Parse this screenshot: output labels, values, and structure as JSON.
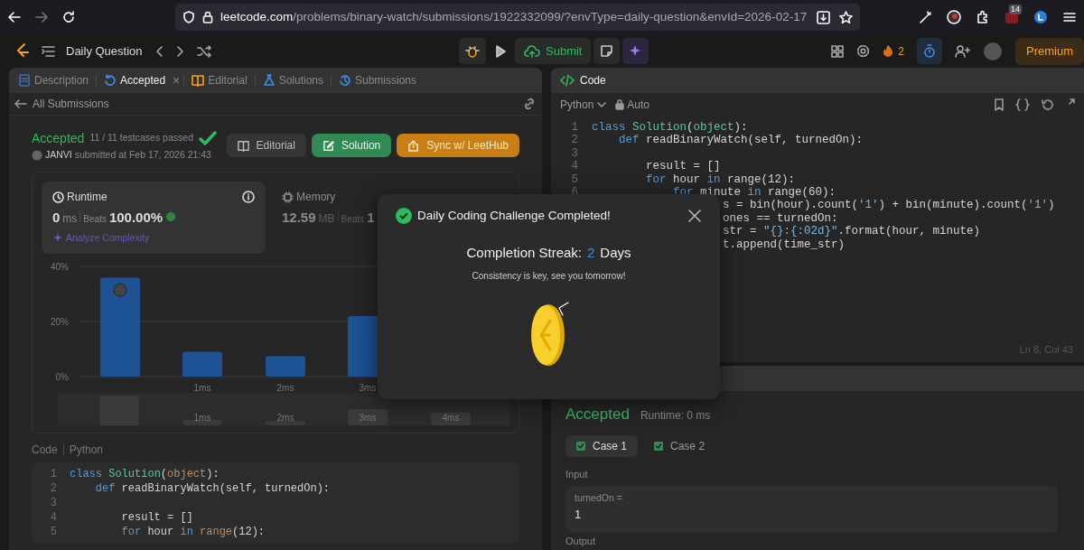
{
  "browser": {
    "url_host": "leetcode.com",
    "url_path": "/problems/binary-watch/submissions/1922332099/?envType=daily-question&envId=2026-02-17",
    "extension_badge": "14"
  },
  "top_nav": {
    "title": "Daily Question",
    "submit": "Submit",
    "streak_count": "2",
    "premium": "Premium"
  },
  "left_panel": {
    "tabs": [
      {
        "label": "Description",
        "selected": false
      },
      {
        "label": "Accepted",
        "selected": true,
        "close": "×"
      },
      {
        "label": "Editorial",
        "selected": false
      },
      {
        "label": "Solutions",
        "selected": false
      },
      {
        "label": "Submissions",
        "selected": false
      }
    ],
    "back_link": "All Submissions",
    "submission": {
      "status": "Accepted",
      "testcases": "11 / 11 testcases passed",
      "user": "JANVI",
      "submitted": "submitted at Feb 17, 2026 21:43"
    },
    "actions": [
      {
        "label": "Editorial",
        "kind": "plain"
      },
      {
        "label": "Solution",
        "kind": "green"
      },
      {
        "label": "Sync w/ LeetHub",
        "kind": "orange"
      }
    ],
    "stats": [
      {
        "title": "Runtime",
        "value": "0",
        "unit": "ms",
        "beats_label": "Beats",
        "beats": "100.00%",
        "link": "Analyze Complexity",
        "selected": true
      },
      {
        "title": "Memory",
        "value": "12.59",
        "unit": "MB",
        "beats_label": "Beats",
        "beats": "1",
        "selected": false
      }
    ],
    "chart_data": {
      "type": "bar",
      "categories": [
        null,
        "1ms",
        "2ms",
        "3ms"
      ],
      "values": [
        36,
        9,
        7.5,
        22
      ],
      "ylim": [
        0,
        40
      ],
      "yticks": [
        {
          "value": 0,
          "label": "0%"
        },
        {
          "value": 20,
          "label": "20%"
        },
        {
          "value": 40,
          "label": "40%"
        }
      ]
    },
    "navigator_labels": [
      "1ms",
      "2ms",
      "3ms",
      "4ms"
    ],
    "code_label": "Code",
    "code_language": "Python",
    "code": [
      {
        "number": "1",
        "segments": [
          {
            "text": "class",
            "kind": "keyword"
          },
          {
            "text": " Solution",
            "kind": "class"
          },
          {
            "text": "(",
            "kind": "plain"
          },
          {
            "text": "object",
            "kind": "builtin"
          },
          {
            "text": "):",
            "kind": "plain"
          }
        ]
      },
      {
        "number": "2",
        "segments": [
          {
            "text": "    def",
            "kind": "keyword"
          },
          {
            "text": " readBinaryWatch(self, turnedOn):",
            "kind": "plain"
          }
        ]
      },
      {
        "number": "3"
      },
      {
        "number": "4",
        "segments": [
          {
            "text": "        result = []",
            "kind": "plain"
          }
        ]
      },
      {
        "number": "5",
        "segments": [
          {
            "text": "        for",
            "kind": "keyword"
          },
          {
            "text": " hour",
            "kind": "plain"
          },
          {
            "text": " in",
            "kind": "keyword"
          },
          {
            "text": " range",
            "kind": "builtin"
          },
          {
            "text": "(12):",
            "kind": "plain"
          }
        ]
      }
    ]
  },
  "editor": {
    "title": "Code",
    "language": "Python",
    "mode": "Auto",
    "lines": [
      {
        "kind": "line",
        "number": "1",
        "segments": [
          {
            "text": "class",
            "kind": "keyword"
          },
          {
            "text": " Solution",
            "kind": "class"
          },
          {
            "text": "(",
            "kind": "plain"
          },
          {
            "text": "object",
            "kind": "class"
          },
          {
            "text": "):",
            "kind": "plain"
          }
        ]
      },
      {
        "kind": "line",
        "number": "2",
        "segments": [
          {
            "text": "    def",
            "kind": "keyword"
          },
          {
            "text": " readBinaryWatch(self, turnedOn):",
            "kind": "plain"
          }
        ]
      },
      {
        "kind": "line",
        "number": "3"
      },
      {
        "kind": "line",
        "number": "4",
        "segments": [
          {
            "text": "        result = []",
            "kind": "plain"
          }
        ]
      },
      {
        "kind": "line",
        "number": "5",
        "segments": [
          {
            "text": "        for",
            "kind": "keyword"
          },
          {
            "text": " hour",
            "kind": "plain"
          },
          {
            "text": " in",
            "kind": "keyword"
          },
          {
            "text": " range(12):",
            "kind": "plain"
          }
        ]
      },
      {
        "kind": "line",
        "number": "6",
        "segments": [
          {
            "text": "            for",
            "kind": "keyword"
          },
          {
            "text": " minute",
            "kind": "plain"
          },
          {
            "text": " in",
            "kind": "keyword"
          },
          {
            "text": " range(60):",
            "kind": "plain"
          }
        ]
      },
      {
        "kind": "fragment",
        "segments": [
          {
            "text": "s = bin(hour).count(",
            "kind": "plain"
          },
          {
            "text": "'1'",
            "kind": "string"
          },
          {
            "text": ") + bin(minute).count(",
            "kind": "plain"
          },
          {
            "text": "'1'",
            "kind": "string"
          },
          {
            "text": ")",
            "kind": "plain"
          }
        ]
      },
      {
        "kind": "fragment",
        "segments": [
          {
            "text": "ones == turnedOn:",
            "kind": "plain"
          }
        ]
      },
      {
        "kind": "fragment",
        "segments": [
          {
            "text": "str = ",
            "kind": "plain"
          },
          {
            "text": "\"{}:{:02d}\"",
            "kind": "string"
          },
          {
            "text": ".format(hour, minute)",
            "kind": "plain"
          }
        ]
      },
      {
        "kind": "fragment",
        "segments": [
          {
            "text": "t.append(time_str)",
            "kind": "plain"
          }
        ]
      }
    ],
    "cursor": "Ln 8, Col 43"
  },
  "result": {
    "status": "Accepted",
    "runtime": "Runtime: 0 ms",
    "cases": [
      {
        "label": "Case 1",
        "selected": true,
        "passed": true
      },
      {
        "label": "Case 2",
        "selected": false,
        "passed": true
      }
    ],
    "input_label": "Input",
    "params": [
      {
        "name": "turnedOn =",
        "value": "1"
      }
    ],
    "output_label": "Output"
  },
  "modal": {
    "title": "Daily Coding Challenge Completed!",
    "streak_label": "Completion Streak:",
    "streak": "2",
    "streak_unit": "Days",
    "message": "Consistency is key, see you tomorrow!"
  }
}
